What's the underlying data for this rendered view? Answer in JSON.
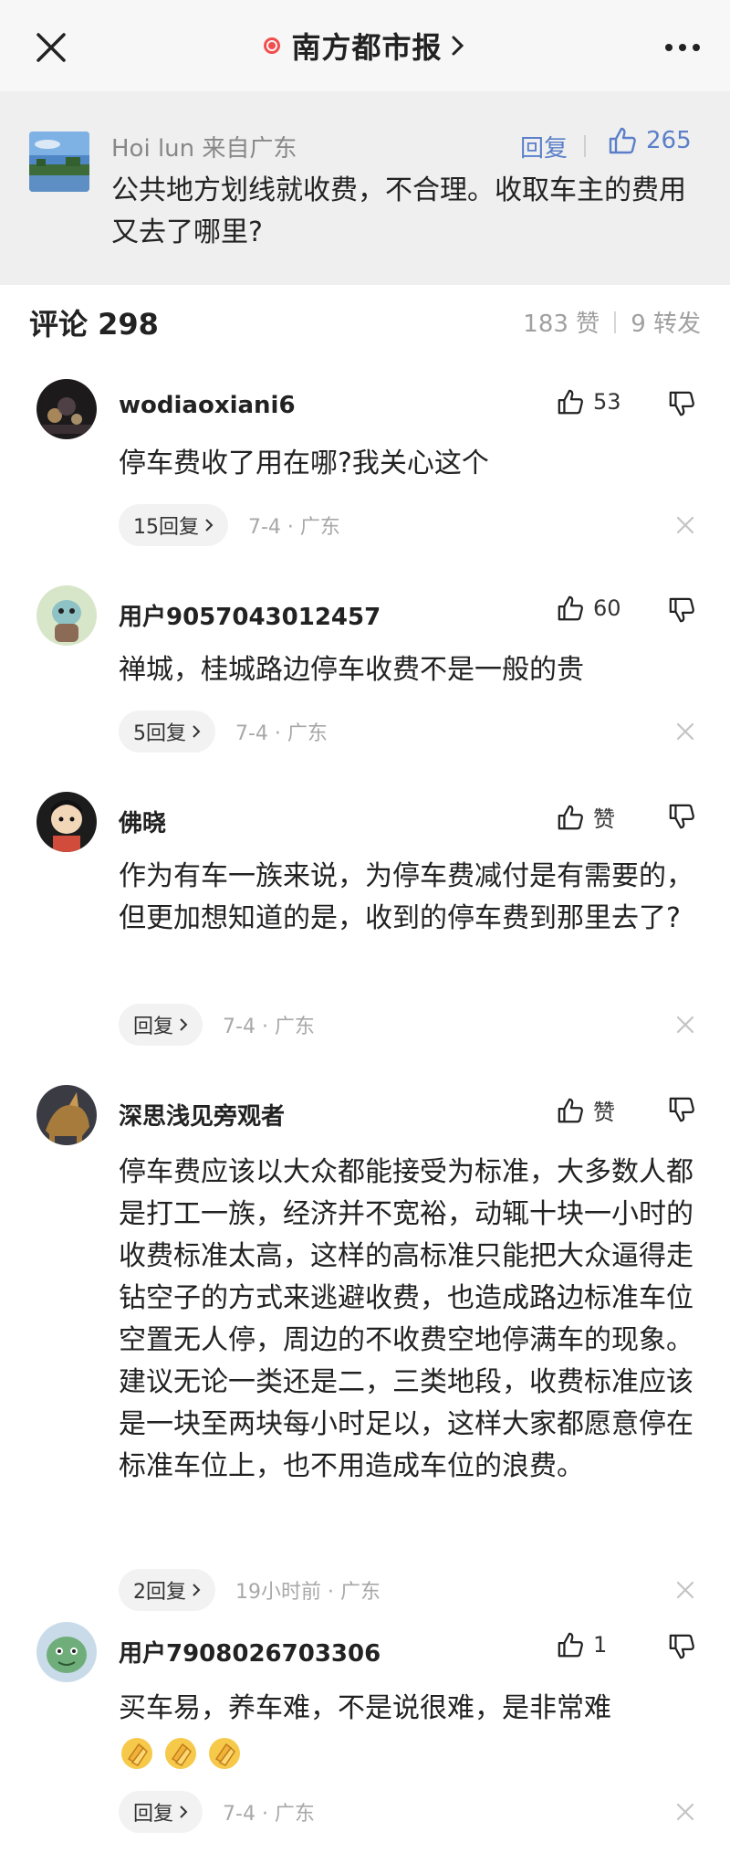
{
  "nav": {
    "title": "南方都市报"
  },
  "quote": {
    "username": "Hoi lun 来自广东",
    "reply_label": "回复",
    "likes": "265",
    "text": "公共地方划线就收费，不合理。收取车主的费用又去了哪里?"
  },
  "comments_header": {
    "label": "评论 298",
    "likes": "183 赞",
    "reposts": "9 转发"
  },
  "comments": [
    {
      "name": "wodiaoxiani6",
      "likes": "53",
      "text": "停车费收了用在哪?我关心这个",
      "reply_label": "15回复",
      "meta": "7-4 · 广东"
    },
    {
      "name": "用户9057043012457",
      "likes": "60",
      "text": "禅城，桂城路边停车收费不是一般的贵",
      "reply_label": "5回复",
      "meta": "7-4 · 广东"
    },
    {
      "name": "佛晓",
      "likes": "赞",
      "text": "作为有车一族来说，为停车费减付是有需要的，但更加想知道的是，收到的停车费到那里去了?",
      "reply_label": "回复",
      "meta": "7-4 · 广东"
    },
    {
      "name": "深思浅见旁观者",
      "likes": "赞",
      "text": "停车费应该以大众都能接受为标准，大多数人都是打工一族，经济并不宽裕，动辄十块一小时的收费标准太高，这样的高标准只能把大众逼得走钻空子的方式来逃避收费，也造成路边标准车位空置无人停，周边的不收费空地停满车的现象。建议无论一类还是二，三类地段，收费标准应该是一块至两块每小时足以，这样大家都愿意停在标准车位上，也不用造成车位的浪费。",
      "reply_label": "2回复",
      "meta": "19小时前 · 广东"
    },
    {
      "name": "用户7908026703306",
      "likes": "1",
      "text": "买车易，养车难，不是说很难，是非常难",
      "reply_label": "回复",
      "meta": "7-4 · 广东"
    }
  ],
  "icons": {
    "close": "close-icon",
    "more": "more-icon",
    "like": "thumbs-up-icon",
    "dislike": "thumbs-down-icon",
    "chevron": "chevron-right-icon",
    "dismiss": "dismiss-x-icon",
    "emoji": "clapping-hands-emoji"
  },
  "colors": {
    "accent_blue": "#5b7fc9",
    "live_dot": "#f24e4e",
    "quote_bg": "#efefef"
  }
}
